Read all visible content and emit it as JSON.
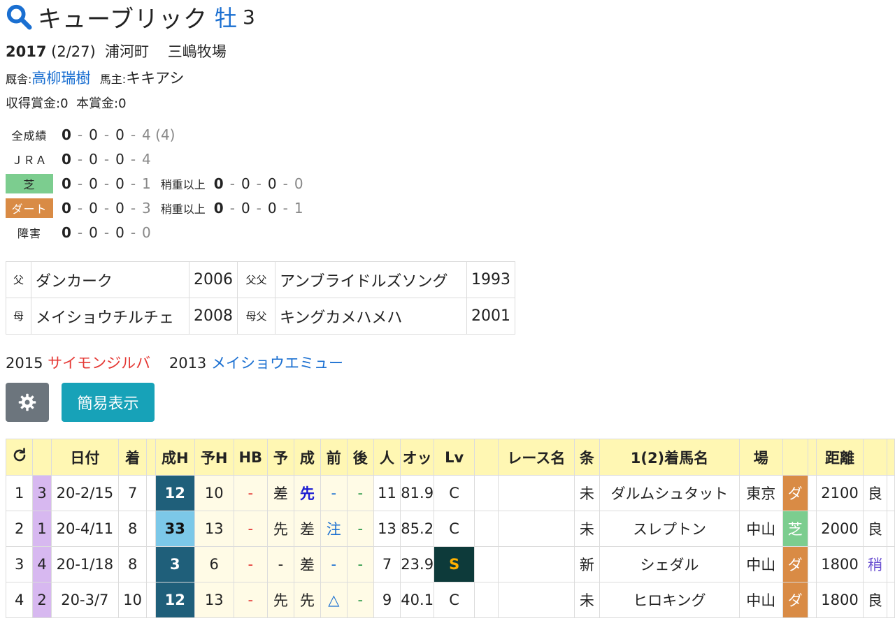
{
  "horse": {
    "name": "キューブリック",
    "sex": "牡",
    "age": "3",
    "birth_year": "2017",
    "birth_date": "(2/27)",
    "region": "浦河町",
    "breeder": "三嶋牧場",
    "trainer_label": "厩舎:",
    "trainer": "高柳瑞樹",
    "owner_label": "馬主:",
    "owner": "キキアシ",
    "earned_label": "収得賞金:",
    "earned": "0",
    "prize_label": "本賞金:",
    "prize": "0"
  },
  "records": [
    {
      "label": "全成績",
      "w1": "0",
      "w2": "0",
      "w3": "0",
      "w4": "4",
      "extra": "(4)"
    },
    {
      "label": "ＪＲＡ",
      "w1": "0",
      "w2": "0",
      "w3": "0",
      "w4": "4"
    },
    {
      "label": "芝",
      "w1": "0",
      "w2": "0",
      "w3": "0",
      "w4": "1",
      "sub_label": "稍重以上",
      "s1": "0",
      "s2": "0",
      "s3": "0",
      "s4": "0"
    },
    {
      "label": "ダート",
      "w1": "0",
      "w2": "0",
      "w3": "0",
      "w4": "3",
      "sub_label": "稍重以上",
      "s1": "0",
      "s2": "0",
      "s3": "0",
      "s4": "1"
    },
    {
      "label": "障害",
      "w1": "0",
      "w2": "0",
      "w3": "0",
      "w4": "0"
    }
  ],
  "pedigree": {
    "sire_label": "父",
    "sire": "ダンカーク",
    "sire_year": "2006",
    "sire_sire_label": "父父",
    "sire_sire": "アンブライドルズソング",
    "sire_sire_year": "1993",
    "dam_label": "母",
    "dam": "メイショウチルチェ",
    "dam_year": "2008",
    "dam_sire_label": "母父",
    "dam_sire": "キングカメハメハ",
    "dam_sire_year": "2001"
  },
  "siblings": [
    {
      "year": "2015",
      "name": "サイモンジルバ",
      "color": "#e53935"
    },
    {
      "year": "2013",
      "name": "メイショウエミュー",
      "color": "#1a6fd1"
    }
  ],
  "buttons": {
    "settings_icon": "gear-icon",
    "simple_view": "簡易表示"
  },
  "table": {
    "headers": [
      "日付",
      "着",
      "成H",
      "予H",
      "HB",
      "予",
      "成",
      "前",
      "後",
      "人",
      "オッ",
      "Lv",
      "レース名",
      "条",
      "1(2)着馬名",
      "場",
      "距離"
    ],
    "refresh_icon": "refresh-icon",
    "rows": [
      {
        "no": "1",
        "grp": "3",
        "date": "20-2/15",
        "rank": "7",
        "h": "12",
        "h_style": "dark",
        "yh": "10",
        "hb": "-",
        "yo": "差",
        "sei": "先",
        "sei_color": "#1a1ad1",
        "mae": "-",
        "ato": "-",
        "pop": "11",
        "odds": "81.9",
        "lv": "C",
        "race": "",
        "cond": "未",
        "winner": "ダルムシュタット",
        "venue": "東京",
        "surface": "ダ",
        "dist": "2100",
        "going": "良"
      },
      {
        "no": "2",
        "grp": "1",
        "date": "20-4/11",
        "rank": "8",
        "h": "33",
        "h_style": "light",
        "yh": "13",
        "hb": "-",
        "yo": "先",
        "sei": "差",
        "sei_color": "#222",
        "mae": "注",
        "ato": "-",
        "pop": "13",
        "odds": "85.2",
        "lv": "C",
        "race": "",
        "cond": "未",
        "winner": "スレプトン",
        "venue": "中山",
        "surface": "芝",
        "dist": "2000",
        "going": "良"
      },
      {
        "no": "3",
        "grp": "4",
        "date": "20-1/18",
        "rank": "8",
        "h": "3",
        "h_style": "dark",
        "yh": "6",
        "hb": "-",
        "yo": "-",
        "sei": "差",
        "sei_color": "#222",
        "mae": "-",
        "ato": "-",
        "pop": "7",
        "odds": "23.9",
        "lv": "S",
        "race": "",
        "cond": "新",
        "winner": "シェダル",
        "venue": "中山",
        "surface": "ダ",
        "dist": "1800",
        "going": "稍"
      },
      {
        "no": "4",
        "grp": "2",
        "date": "20-3/7",
        "rank": "10",
        "h": "12",
        "h_style": "dark",
        "yh": "13",
        "hb": "-",
        "yo": "先",
        "sei": "先",
        "sei_color": "#222",
        "mae": "△",
        "ato": "-",
        "pop": "9",
        "odds": "40.1",
        "lv": "C",
        "race": "",
        "cond": "未",
        "winner": "ヒロキング",
        "venue": "中山",
        "surface": "ダ",
        "dist": "1800",
        "going": "良"
      }
    ]
  }
}
